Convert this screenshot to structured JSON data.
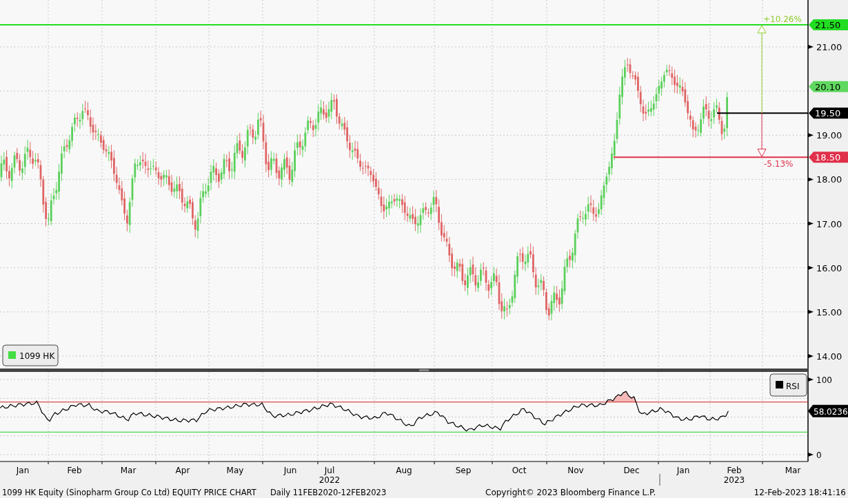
{
  "price_panel": {
    "axis_labels": [
      "21.00",
      "19.00",
      "18.00",
      "17.00",
      "16.00",
      "15.00",
      "14.00"
    ],
    "levels": [
      {
        "kind": "full",
        "label": "21.50",
        "color": "#22dd22"
      },
      {
        "kind": "tag",
        "label": "20.10",
        "color": "#5fd85f"
      },
      {
        "kind": "partial",
        "label": "19.50",
        "color": "#000000"
      },
      {
        "kind": "partial_wide",
        "label": "18.50",
        "color": "#e0304a"
      }
    ],
    "annotations": [
      {
        "kind": "up",
        "text": "+10.26%",
        "color": "#8fcc2a"
      },
      {
        "kind": "down",
        "text": "-5.13%",
        "color": "#e0304a"
      }
    ],
    "legend": {
      "label": "1099 HK",
      "color": "#44dd44"
    }
  },
  "rsi_panel": {
    "axis_labels": [
      "100",
      "0"
    ],
    "legend": {
      "label": "RSI",
      "color": "#000000"
    },
    "tag": "58.0236"
  },
  "x_axis": {
    "months": [
      {
        "label": "Jan"
      },
      {
        "label": "Feb"
      },
      {
        "label": "Mar"
      },
      {
        "label": "Apr"
      },
      {
        "label": "May"
      },
      {
        "label": "Jun"
      },
      {
        "label": "Jul",
        "year": "2022"
      },
      {
        "label": "Aug"
      },
      {
        "label": "Sep"
      },
      {
        "label": "Oct"
      },
      {
        "label": "Nov"
      },
      {
        "label": "Dec"
      },
      {
        "label": "Jan"
      },
      {
        "label": "Feb",
        "year": "2023"
      },
      {
        "label": "Mar"
      }
    ]
  },
  "footer": {
    "title": "1099 HK Equity (Sinopharm Group Co Ltd) EQUITY PRICE CHART",
    "range": "Daily 11FEB2020-12FEB2023",
    "copyright": "Copyright© 2023 Bloomberg Finance L.P.",
    "timestamp": "12-Feb-2023 18:41:16"
  }
}
